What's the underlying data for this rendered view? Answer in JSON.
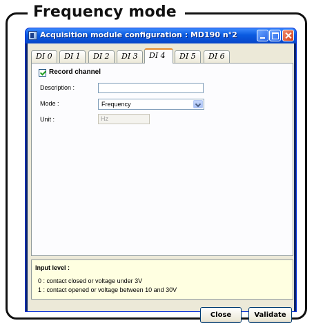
{
  "frame": {
    "title": "Frequency mode"
  },
  "window": {
    "title": "Acquisition module configuration : MD190 n°2"
  },
  "tabs": [
    {
      "label": "DI 0"
    },
    {
      "label": "DI 1"
    },
    {
      "label": "DI 2"
    },
    {
      "label": "DI 3"
    },
    {
      "label": "DI 4",
      "active": true
    },
    {
      "label": "DI 5"
    },
    {
      "label": "DI 6"
    }
  ],
  "form": {
    "record_channel_label": "Record channel",
    "record_channel_checked": true,
    "description_label": "Description :",
    "description_value": "",
    "mode_label": "Mode :",
    "mode_value": "Frequency",
    "unit_label": "Unit :",
    "unit_value": "Hz"
  },
  "info": {
    "title": "Input level :",
    "line1": "0 : contact closed or voltage under 3V",
    "line2": "1 : contact opened or voltage between 10 and 30V"
  },
  "buttons": {
    "close": "Close",
    "validate": "Validate"
  }
}
